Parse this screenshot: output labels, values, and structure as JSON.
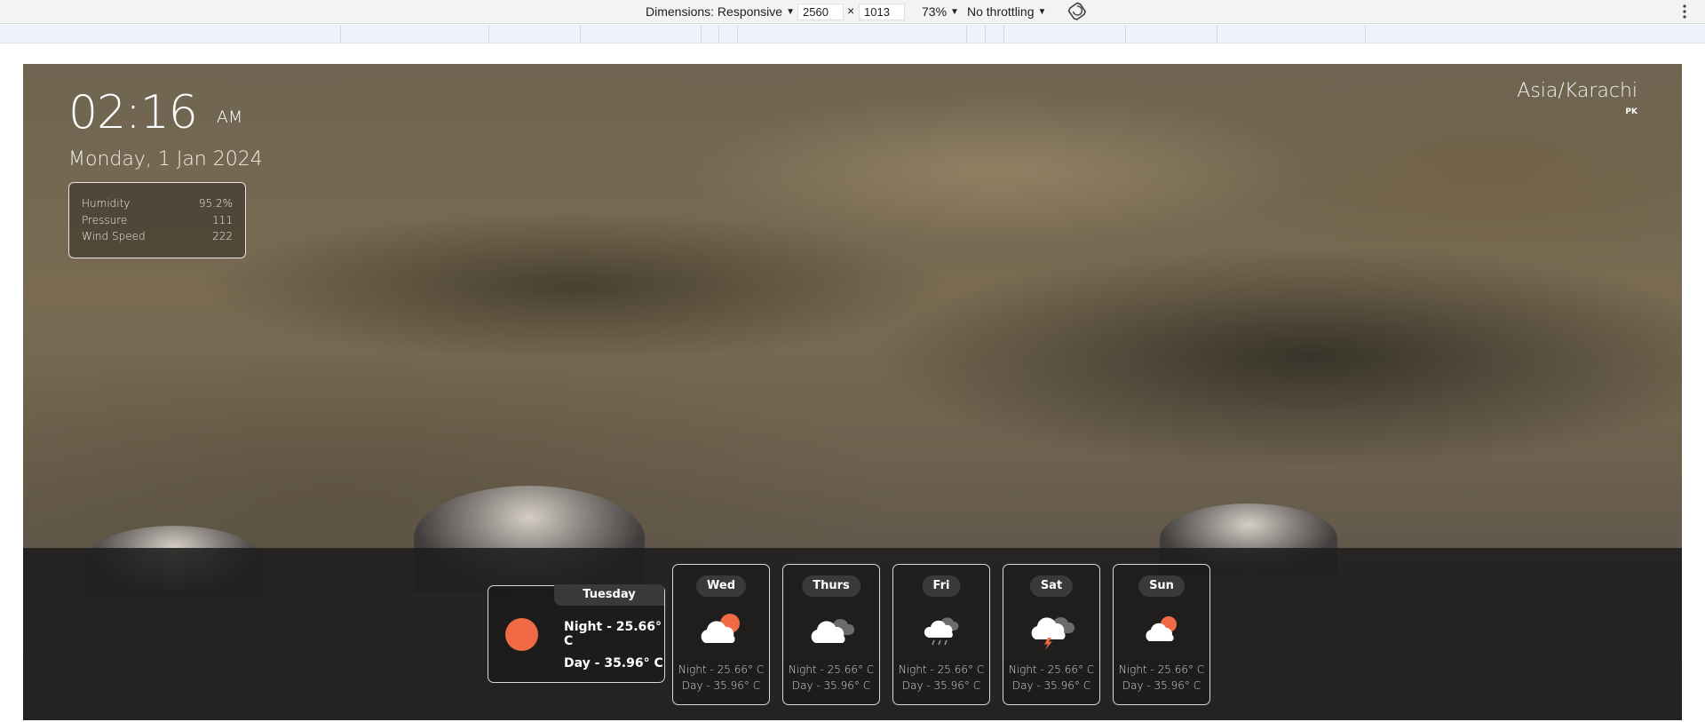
{
  "devtools": {
    "dimensions_label": "Dimensions: Responsive",
    "width_value": "2560",
    "times": "×",
    "height_value": "1013",
    "zoom_label": "73%",
    "throttle_label": "No throttling"
  },
  "weather": {
    "time": "02:16",
    "ampm": "AM",
    "date": "Monday, 1 Jan 2024",
    "timezone": "Asia/Karachi",
    "country": "PK",
    "stats": [
      {
        "label": "Humidity",
        "value": "95.2%"
      },
      {
        "label": "Pressure",
        "value": "111"
      },
      {
        "label": "Wind Speed",
        "value": "222"
      }
    ],
    "today": {
      "day": "Tuesday",
      "night": "Night - 25.66° C",
      "dayTemp": "Day - 35.96° C",
      "icon": "sun-icon"
    },
    "forecast": [
      {
        "day": "Wed",
        "icon": "partly-cloudy-sun-icon",
        "night": "Night - 25.66° C",
        "dayTemp": "Day - 35.96° C"
      },
      {
        "day": "Thurs",
        "icon": "cloudy-icon",
        "night": "Night - 25.66° C",
        "dayTemp": "Day - 35.96° C"
      },
      {
        "day": "Fri",
        "icon": "rain-cloud-icon",
        "night": "Night - 25.66° C",
        "dayTemp": "Day - 35.96° C"
      },
      {
        "day": "Sat",
        "icon": "thunderstorm-icon",
        "night": "Night - 25.66° C",
        "dayTemp": "Day - 35.96° C"
      },
      {
        "day": "Sun",
        "icon": "partly-cloudy-sun-icon",
        "night": "Night - 25.66° C",
        "dayTemp": "Day - 35.96° C"
      }
    ],
    "accent_color": "#ef6a45"
  }
}
